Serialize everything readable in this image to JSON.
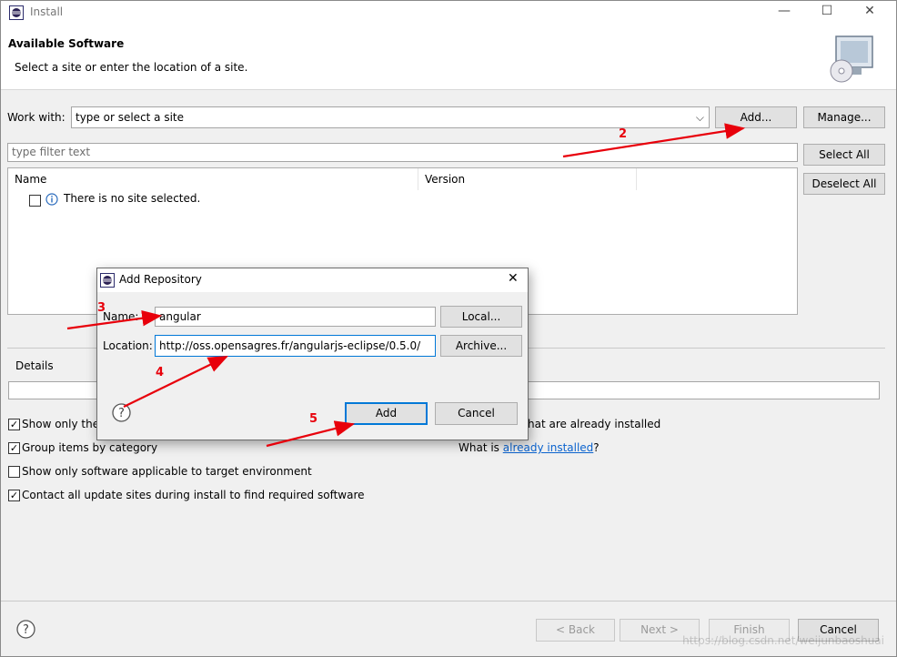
{
  "window": {
    "title": "Install",
    "minimize": "—",
    "maximize": "☐",
    "close": "✕"
  },
  "header": {
    "title": "Available Software",
    "description": "Select a site or enter the location of a site."
  },
  "work_with": {
    "label": "Work with:",
    "value": "type or select a site",
    "add": "Add...",
    "manage": "Manage..."
  },
  "filter": {
    "placeholder": "type filter text"
  },
  "table": {
    "columns": [
      "Name",
      "Version"
    ],
    "rows": [
      {
        "name": "There is no site selected."
      }
    ]
  },
  "side_buttons": {
    "select_all": "Select All",
    "deselect_all": "Deselect All"
  },
  "details": {
    "label": "Details"
  },
  "options": {
    "show_latest": "Show only the",
    "already_installed_tail": "hat are already installed",
    "group_by_category": "Group items by category",
    "what_is": "What is ",
    "already_installed_link": "already installed",
    "question": "?",
    "applicable": "Show only software applicable to target environment",
    "contact_sites": "Contact all update sites during install to find required software"
  },
  "footer": {
    "back": "< Back",
    "next": "Next >",
    "finish": "Finish",
    "cancel": "Cancel"
  },
  "dialog": {
    "title": "Add Repository",
    "name_label": "Name:",
    "name_value": "angular",
    "location_label": "Location:",
    "location_value": "http://oss.opensagres.fr/angularjs-eclipse/0.5.0/",
    "local": "Local...",
    "archive": "Archive...",
    "add": "Add",
    "cancel": "Cancel"
  },
  "annotations": [
    "2",
    "3",
    "4",
    "5"
  ],
  "watermark": "https://blog.csdn.net/weijunbaoshuai",
  "colors": {
    "annotation": "#e8000b",
    "link": "#0b63ce",
    "focus": "#0078d7"
  },
  "icons": [
    "eclipse-icon",
    "info-icon",
    "help-icon",
    "software-install-icon"
  ]
}
